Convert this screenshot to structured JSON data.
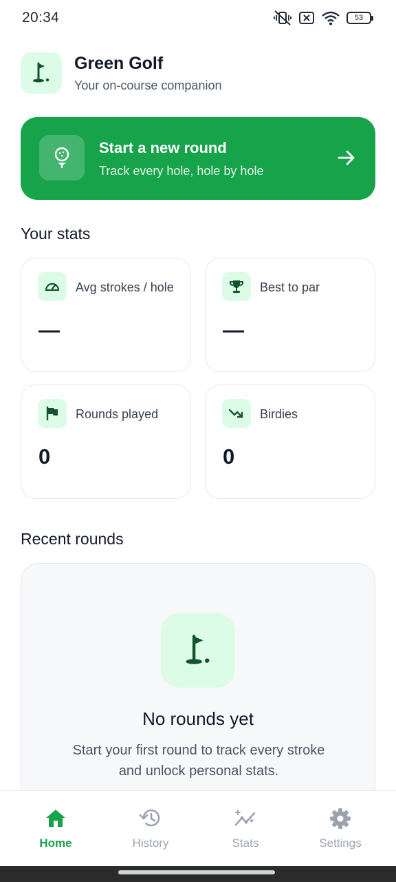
{
  "status_bar": {
    "time": "20:34",
    "battery": "53"
  },
  "header": {
    "title": "Green Golf",
    "subtitle": "Your on-course companion"
  },
  "start_round": {
    "title": "Start a new round",
    "subtitle": "Track every hole, hole by hole"
  },
  "stats": {
    "section_title": "Your stats",
    "cards": [
      {
        "label": "Avg strokes / hole",
        "value": "—",
        "icon": "speedometer-icon"
      },
      {
        "label": "Best to par",
        "value": "—",
        "icon": "trophy-icon"
      },
      {
        "label": "Rounds played",
        "value": "0",
        "icon": "flag-icon"
      },
      {
        "label": "Birdies",
        "value": "0",
        "icon": "trending-down-icon"
      }
    ]
  },
  "recent": {
    "section_title": "Recent rounds",
    "empty_title": "No rounds yet",
    "empty_text": "Start your first round to track every stroke and unlock personal stats."
  },
  "nav": {
    "items": [
      {
        "label": "Home",
        "icon": "home-icon",
        "active": true
      },
      {
        "label": "History",
        "icon": "history-icon",
        "active": false
      },
      {
        "label": "Stats",
        "icon": "stats-icon",
        "active": false
      },
      {
        "label": "Settings",
        "icon": "gear-icon",
        "active": false
      }
    ]
  },
  "colors": {
    "accent": "#16a34a",
    "accent_light": "#dcfce7",
    "icon_dark": "#14532d"
  }
}
